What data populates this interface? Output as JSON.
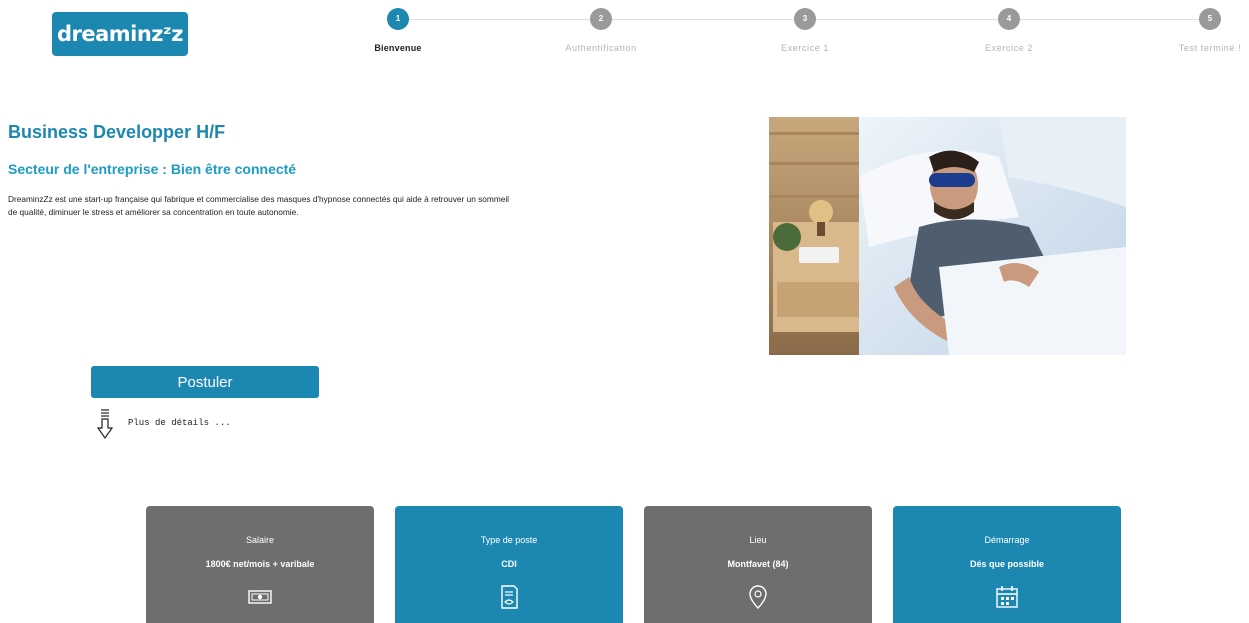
{
  "header": {
    "logo_text": "dreaminzᶻz",
    "brand_color": "#1c88b1",
    "steps": [
      {
        "number": "1",
        "label": "Bienvenue",
        "active": true
      },
      {
        "number": "2",
        "label": "Authentification",
        "active": false
      },
      {
        "number": "3",
        "label": "Exercice 1",
        "active": false
      },
      {
        "number": "4",
        "label": "Exercice 2",
        "active": false
      },
      {
        "number": "5",
        "label": "Test terminé !",
        "active": false
      }
    ]
  },
  "job": {
    "title": "Business Developper H/F",
    "sector": "Secteur de l'entreprise : Bien être connecté",
    "description": "DreaminzZz est une start-up française qui fabrique et commercialise des masques d'hypnose connectés qui aide à retrouver un sommeil de qualité, diminuer le stress et améliorer sa concentration en toute autonomie."
  },
  "actions": {
    "apply_label": "Postuler",
    "more_details_label": "Plus de détails ..."
  },
  "cards": [
    {
      "title": "Salaire",
      "value": "1800€ net/mois + varibale",
      "icon": "money-icon",
      "color": "#6e6e6e"
    },
    {
      "title": "Type de poste",
      "value": "CDI",
      "icon": "contract-icon",
      "color": "#1c88b1"
    },
    {
      "title": "Lieu",
      "value": "Montfavet (84)",
      "icon": "location-pin-icon",
      "color": "#6e6e6e"
    },
    {
      "title": "Démarrage",
      "value": "Dés que possible",
      "icon": "calendar-icon",
      "color": "#1c88b1"
    }
  ]
}
